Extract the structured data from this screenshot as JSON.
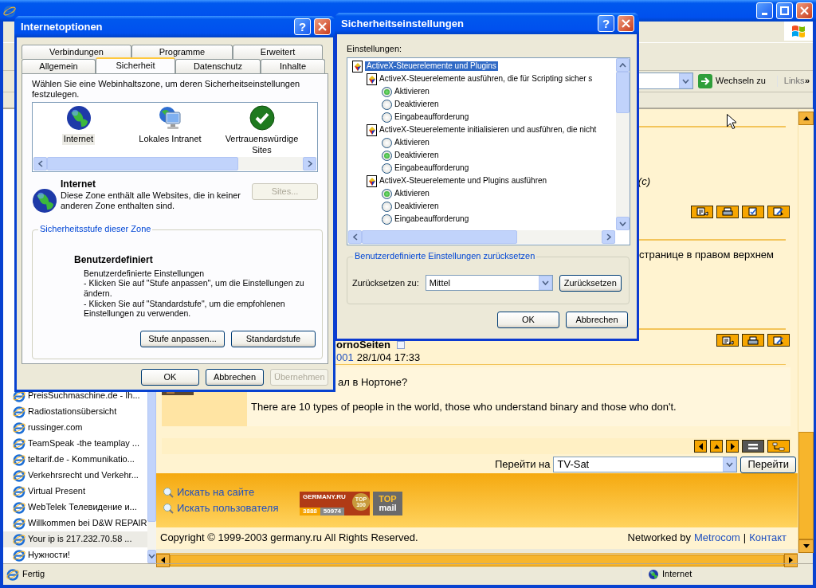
{
  "browser": {
    "address_bar": {
      "go_button": "Wechseln zu",
      "links_label": "Links",
      "more_chevron": "»"
    },
    "sidebar": {
      "items": [
        {
          "label": "PreisSuchmaschine.de - Ih...",
          "selected": false
        },
        {
          "label": "Radiostationsübersicht",
          "selected": false
        },
        {
          "label": "russinger.com",
          "selected": false
        },
        {
          "label": "TeamSpeak -the teamplay ...",
          "selected": false
        },
        {
          "label": "teltarif.de - Kommunikatio...",
          "selected": false
        },
        {
          "label": "Verkehrsrecht und Verkehr...",
          "selected": false
        },
        {
          "label": "Virtual Present",
          "selected": false
        },
        {
          "label": "WebTelek Телевидение и...",
          "selected": false
        },
        {
          "label": "Willkommen bei D&W REPAIR",
          "selected": false
        },
        {
          "label": "Your ip is 217.232.70.58 ...",
          "selected": true
        },
        {
          "label": "Нужности!",
          "selected": false
        }
      ]
    },
    "page": {
      "post_1": {
        "signature_fragment": "(c)"
      },
      "post_2": {
        "text_fragment": "странице в правом верхнем"
      },
      "post_3": {
        "author_fragment": "ornoSeiten",
        "link_fragment": "001",
        "date": "28/1/04 17:33",
        "question_fragment": "ал в Нортоне?",
        "signature": "There are 10 types of people in the world, those who understand binary and those who don't."
      },
      "jump": {
        "label": "Перейти на",
        "value": "TV-Sat",
        "button": "Перейти"
      },
      "footer": {
        "links": [
          "Искать на сайте",
          "Искать пользователя"
        ],
        "counter_banner": {
          "title": "GERMANY.RU",
          "hits": "3888",
          "visits": "50974",
          "seal": "TOP 100"
        },
        "mail_banner": {
          "top": "TOP",
          "bottom": "mail"
        }
      },
      "copyright": "Copyright © 1999-2003 germany.ru All Rights Reserved.",
      "networked_by": "Networked by",
      "network_link": "Metrocom",
      "separator": "|",
      "contact_link": "Контакт"
    },
    "status_bar": {
      "text": "Fertig",
      "zone": "Internet"
    }
  },
  "internet_options": {
    "title": "Internetoptionen",
    "help_button": "?",
    "tab_rows": [
      [
        {
          "label": "Verbindungen",
          "selected": false
        },
        {
          "label": "Programme",
          "selected": false
        },
        {
          "label": "Erweitert",
          "selected": false
        }
      ],
      [
        {
          "label": "Allgemein",
          "selected": false
        },
        {
          "label": "Sicherheit",
          "selected": true
        },
        {
          "label": "Datenschutz",
          "selected": false
        },
        {
          "label": "Inhalte",
          "selected": false
        }
      ]
    ],
    "intro": "Wählen Sie eine Webinhaltszone, um deren Sicherheitseinstellungen festzulegen.",
    "zones": [
      {
        "label": "Internet",
        "kind": "globe",
        "selected": true
      },
      {
        "label": "Lokales Intranet",
        "kind": "intranet",
        "selected": false
      },
      {
        "label": "Vertrauenswürdige Sites",
        "kind": "trusted",
        "selected": false
      }
    ],
    "zone_name": "Internet",
    "zone_description": "Diese Zone enthält alle Websites, die in keiner anderen Zone enthalten sind.",
    "sites_button": {
      "label": "Sites...",
      "disabled": true
    },
    "level_group": {
      "legend": "Sicherheitsstufe dieser Zone",
      "level_name": "Benutzerdefiniert",
      "lines": [
        "Benutzerdefinierte Einstellungen",
        "- Klicken Sie auf \"Stufe anpassen\", um die Einstellungen zu ändern.",
        "- Klicken Sie auf \"Standardstufe\", um die empfohlenen Einstellungen zu verwenden."
      ],
      "buttons": [
        "Stufe anpassen...",
        "Standardstufe"
      ]
    },
    "buttons": [
      {
        "label": "OK",
        "disabled": false
      },
      {
        "label": "Abbrechen",
        "disabled": false
      },
      {
        "label": "Übernehmen",
        "disabled": true
      }
    ]
  },
  "security_settings": {
    "title": "Sicherheitseinstellungen",
    "help_button": "?",
    "settings_label": "Einstellungen:",
    "tree": {
      "label": "ActiveX-Steuerelemente und Plugins",
      "selected": true,
      "children": [
        {
          "label": "ActiveX-Steuerelemente ausführen, die für Scripting sicher s",
          "options": [
            {
              "label": "Aktivieren",
              "selected": true
            },
            {
              "label": "Deaktivieren",
              "selected": false
            },
            {
              "label": "Eingabeaufforderung",
              "selected": false
            }
          ]
        },
        {
          "label": "ActiveX-Steuerelemente initialisieren und ausführen, die nicht",
          "options": [
            {
              "label": "Aktivieren",
              "selected": false
            },
            {
              "label": "Deaktivieren",
              "selected": true
            },
            {
              "label": "Eingabeaufforderung",
              "selected": false
            }
          ]
        },
        {
          "label": "ActiveX-Steuerelemente und Plugins ausführen",
          "options": [
            {
              "label": "Aktivieren",
              "selected": true
            },
            {
              "label": "Deaktivieren",
              "selected": false
            },
            {
              "label": "Eingabeaufforderung",
              "selected": false
            }
          ]
        }
      ]
    },
    "reset_group": {
      "legend": "Benutzerdefinierte Einstellungen zurücksetzen",
      "label": "Zurücksetzen zu:",
      "value": "Mittel",
      "button": "Zurücksetzen"
    },
    "buttons": [
      "OK",
      "Abbrechen"
    ]
  }
}
